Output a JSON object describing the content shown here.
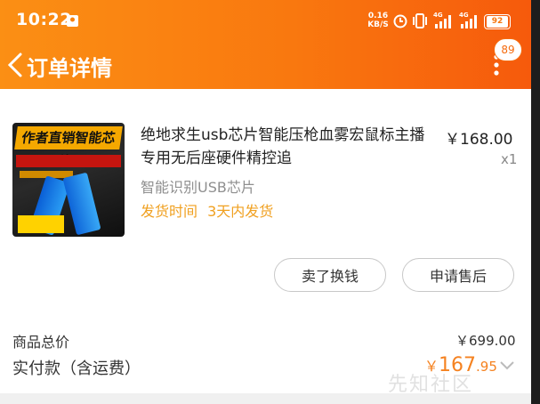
{
  "status": {
    "time": "10:22",
    "net_speed": "0.16",
    "net_unit": "KB/S",
    "battery": "92",
    "signal1": "4G",
    "signal2": "4G"
  },
  "nav": {
    "title": "订单详情",
    "badge": "89"
  },
  "product": {
    "image_title": "作者直销智能芯片",
    "name": "绝地求生usb芯片智能压枪血雾宏鼠标主播专用无后座硬件精控追",
    "price": "￥168.00",
    "qty": "x1",
    "spec": "智能识别USB芯片",
    "ship_label": "发货时间",
    "ship_value": "3天内发货"
  },
  "actions": {
    "btn1": "卖了换钱",
    "btn2": "申请售后"
  },
  "totals": {
    "goods_label": "商品总价",
    "goods_value": "￥699.00",
    "paid_label": "实付款（含运费）",
    "paid_currency": "￥",
    "paid_int": "167",
    "paid_dec": ".95"
  },
  "watermark": "先知社区",
  "colors": {
    "accent": "#f58220",
    "header_start": "#fb8f14",
    "header_end": "#f65a0c",
    "ship_text": "#f0a020"
  }
}
